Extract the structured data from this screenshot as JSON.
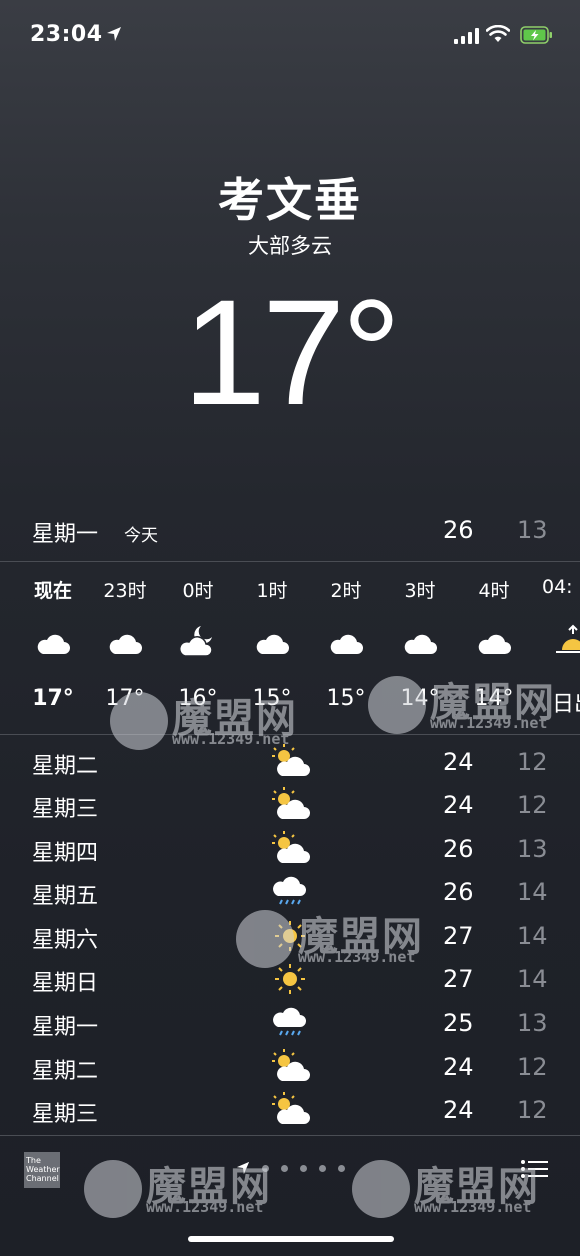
{
  "status_bar": {
    "time": "23:04"
  },
  "location": {
    "city": "考文垂",
    "condition": "大部多云",
    "temperature": "17°"
  },
  "today": {
    "day": "星期一",
    "tag": "今天",
    "high": "26",
    "low": "13"
  },
  "hourly": [
    {
      "label": "现在",
      "icon": "cloud-icon",
      "temp": "17°"
    },
    {
      "label": "23时",
      "icon": "cloud-icon",
      "temp": "17°"
    },
    {
      "label": "0时",
      "icon": "moon-cloud-icon",
      "temp": "16°"
    },
    {
      "label": "1时",
      "icon": "cloud-icon",
      "temp": "15°"
    },
    {
      "label": "2时",
      "icon": "cloud-icon",
      "temp": "15°"
    },
    {
      "label": "3时",
      "icon": "cloud-icon",
      "temp": "14°"
    },
    {
      "label": "4时",
      "icon": "cloud-icon",
      "temp": "14°"
    },
    {
      "label": "04:",
      "icon": "sunrise-icon",
      "temp": "日出"
    }
  ],
  "daily": [
    {
      "day": "星期二",
      "icon": "partly-sunny-icon",
      "high": "24",
      "low": "12"
    },
    {
      "day": "星期三",
      "icon": "partly-sunny-icon",
      "high": "24",
      "low": "12"
    },
    {
      "day": "星期四",
      "icon": "partly-sunny-icon",
      "high": "26",
      "low": "13"
    },
    {
      "day": "星期五",
      "icon": "rain-cloud-icon",
      "high": "26",
      "low": "14"
    },
    {
      "day": "星期六",
      "icon": "sun-icon",
      "high": "27",
      "low": "14"
    },
    {
      "day": "星期日",
      "icon": "sun-icon",
      "high": "27",
      "low": "14"
    },
    {
      "day": "星期一",
      "icon": "rain-cloud-icon",
      "high": "25",
      "low": "13"
    },
    {
      "day": "星期二",
      "icon": "partly-sunny-icon",
      "high": "24",
      "low": "12"
    },
    {
      "day": "星期三",
      "icon": "partly-sunny-icon",
      "high": "24",
      "low": "12"
    }
  ],
  "footer": {
    "provider_logo": "The Weather Channel"
  },
  "watermark": {
    "brand": "魔盟网",
    "url": "www.12349.net"
  },
  "colors": {
    "accent_sun": "#f5c542",
    "low_temp": "#8a8d94",
    "divider": "#4a4d54"
  }
}
